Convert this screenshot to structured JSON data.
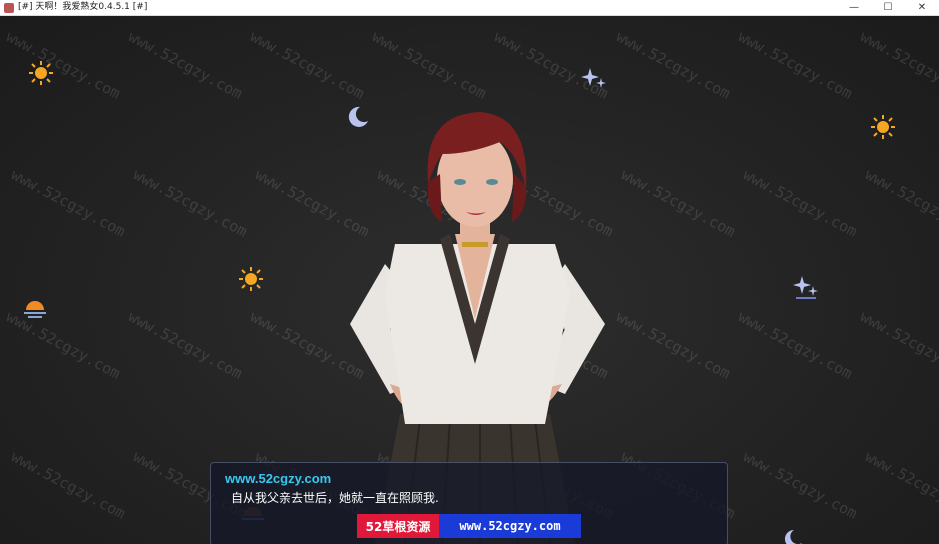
{
  "window": {
    "title": "[#] 天啊！我爱熟女0.4.5.1 [#]",
    "minimize_glyph": "—",
    "maximize_glyph": "☐",
    "close_glyph": "✕"
  },
  "watermark": {
    "text": "www.52cgzy.com"
  },
  "dialog": {
    "speaker": "www.52cgzy.com",
    "text": "自从我父亲去世后，她就一直在照顾我.",
    "ad_left": "52草根资源",
    "ad_right": "www.52cgzy.com"
  },
  "decorations": [
    "sun-icon",
    "moon-icon",
    "stars-icon",
    "sunset-icon"
  ],
  "colors": {
    "speaker": "#38c8ee",
    "ad_left_bg": "#e0193a",
    "ad_right_bg": "#1a3bd8",
    "sun": "#f5a623",
    "moon": "#b9c3f0"
  }
}
